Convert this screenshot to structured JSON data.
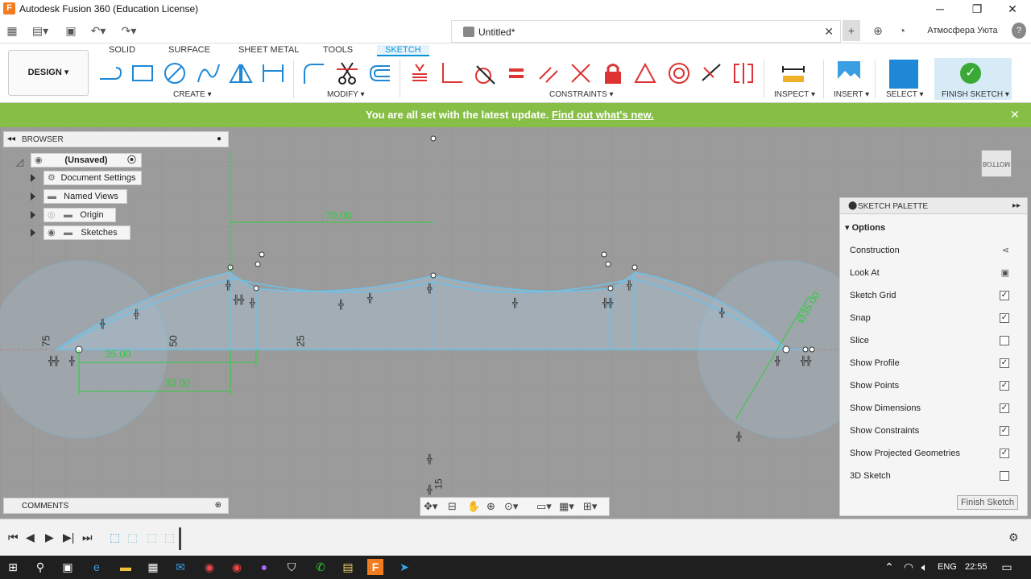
{
  "window": {
    "title": "Autodesk Fusion 360 (Education License)",
    "logo": "F",
    "min": "─",
    "max": "❐",
    "close": "✕"
  },
  "quickbar": {
    "user": "Атмосфера Уюта",
    "help_icon": "?"
  },
  "doc": {
    "name": "Untitled*",
    "close": "✕",
    "plus": "+"
  },
  "ribbon": {
    "tabs": [
      "SOLID",
      "SURFACE",
      "SHEET METAL",
      "TOOLS",
      "SKETCH"
    ],
    "workspace": "DESIGN ▾",
    "groups": {
      "create": "CREATE ▾",
      "modify": "MODIFY ▾",
      "constraints": "CONSTRAINTS ▾",
      "inspect": "INSPECT ▾",
      "insert": "INSERT ▾",
      "select": "SELECT ▾",
      "finish": "FINISH SKETCH ▾"
    }
  },
  "banner": {
    "message": "You are all set with the latest update.",
    "link": "Find out what's new.",
    "close": "✕"
  },
  "browser": {
    "title": "BROWSER",
    "root": "(Unsaved)",
    "items": [
      "Document Settings",
      "Named Views",
      "Origin",
      "Sketches"
    ]
  },
  "sketch": {
    "dims": [
      "70.00",
      "35.00",
      "30.00",
      "Ø35.00",
      "75",
      "50",
      "25",
      "15"
    ]
  },
  "viewcube": {
    "label": "BOTTOM"
  },
  "palette": {
    "title": "SKETCH PALETTE",
    "section": "Options",
    "rows": [
      {
        "label": "Construction",
        "type": "icon"
      },
      {
        "label": "Look At",
        "type": "icon"
      },
      {
        "label": "Sketch Grid",
        "checked": true
      },
      {
        "label": "Snap",
        "checked": true
      },
      {
        "label": "Slice",
        "checked": false
      },
      {
        "label": "Show Profile",
        "checked": true
      },
      {
        "label": "Show Points",
        "checked": true
      },
      {
        "label": "Show Dimensions",
        "checked": true
      },
      {
        "label": "Show Constraints",
        "checked": true
      },
      {
        "label": "Show Projected Geometries",
        "checked": true
      },
      {
        "label": "3D Sketch",
        "checked": false
      }
    ],
    "finish": "Finish Sketch"
  },
  "comments": {
    "title": "COMMENTS"
  },
  "taskbar": {
    "lang": "ENG",
    "time": "22:55"
  },
  "colors": {
    "accent": "#0696d7",
    "banner": "#87be45",
    "sketch": "#6ec1e8",
    "dim": "#2ecc40"
  }
}
